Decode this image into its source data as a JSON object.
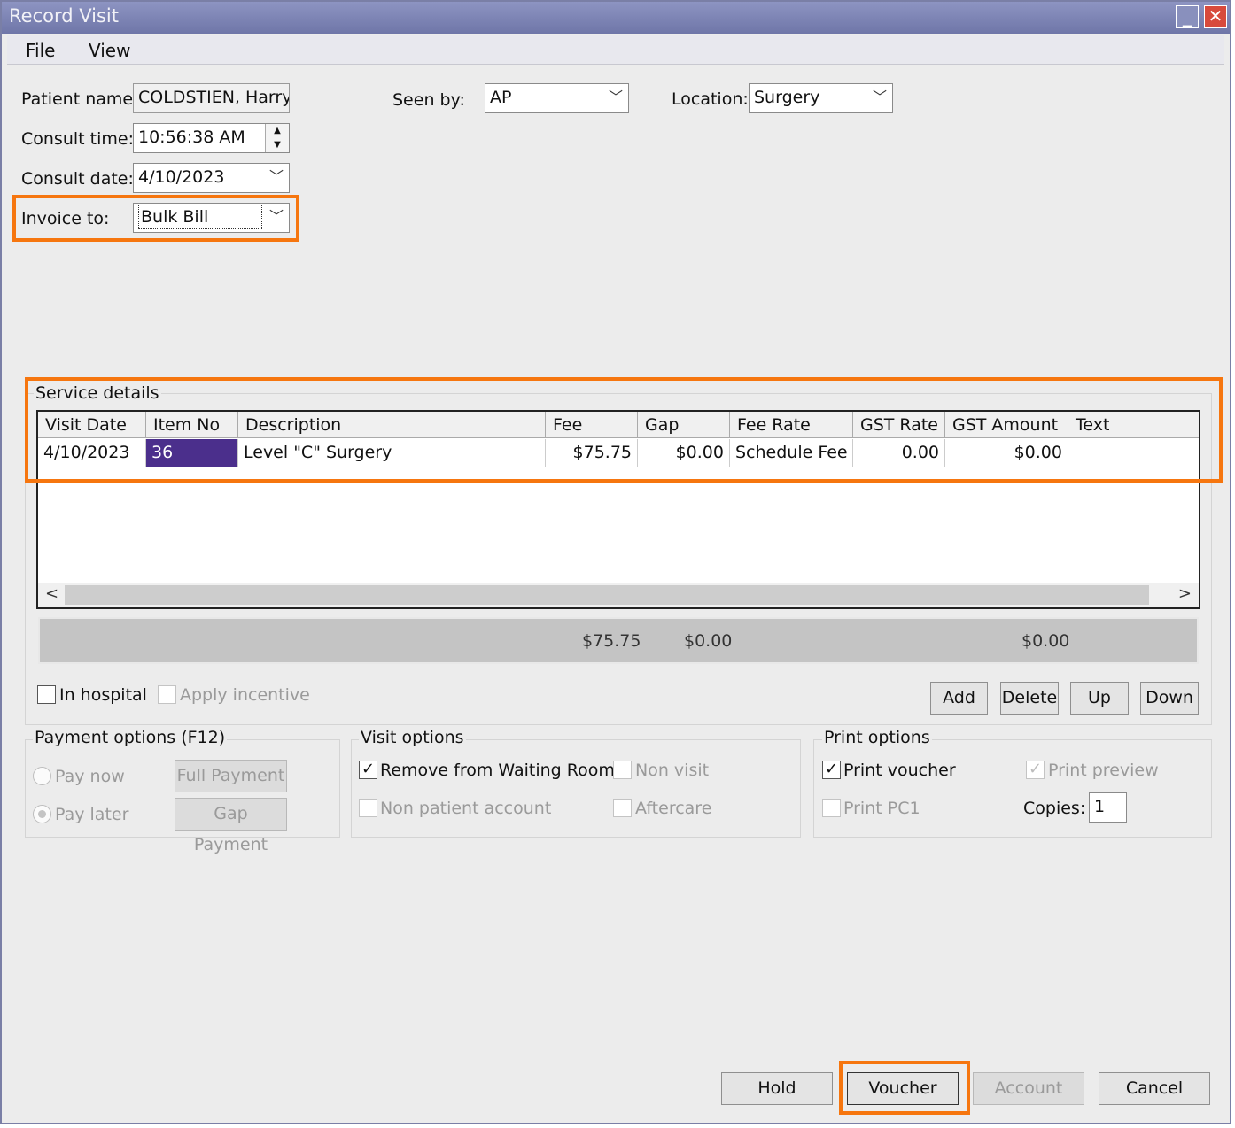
{
  "window": {
    "title": "Record Visit",
    "minimize_glyph": "_",
    "close_glyph": "✕"
  },
  "menu": {
    "file": "File",
    "view": "View"
  },
  "form": {
    "patient_name_label": "Patient name:",
    "patient_name_value": "COLDSTIEN, Harry",
    "consult_time_label": "Consult time:",
    "consult_time_value": "10:56:38 AM",
    "consult_date_label": "Consult date:",
    "consult_date_value": "4/10/2023",
    "invoice_to_label": "Invoice to:",
    "invoice_to_value": "Bulk Bill",
    "seen_by_label": "Seen by:",
    "seen_by_value": "AP",
    "location_label": "Location:",
    "location_value": "Surgery"
  },
  "service": {
    "title": "Service details",
    "columns": [
      "Visit Date",
      "Item No",
      "Description",
      "Fee",
      "Gap",
      "Fee Rate",
      "GST Rate",
      "GST Amount",
      "Text"
    ],
    "rows": [
      {
        "visit_date": "4/10/2023",
        "item_no": "36",
        "description": "Level \"C\" Surgery",
        "fee": "$75.75",
        "gap": "$0.00",
        "fee_rate": "Schedule Fee",
        "gst_rate": "0.00",
        "gst_amount": "$0.00",
        "text": ""
      }
    ],
    "totals": {
      "fee": "$75.75",
      "gap": "$0.00",
      "gst_amount": "$0.00"
    },
    "in_hospital_label": "In hospital",
    "apply_incentive_label": "Apply incentive",
    "add_label": "Add",
    "delete_label": "Delete",
    "up_label": "Up",
    "down_label": "Down"
  },
  "payment": {
    "title": "Payment options (F12)",
    "pay_now": "Pay now",
    "pay_later": "Pay later",
    "full_payment": "Full Payment",
    "gap_payment": "Gap Payment"
  },
  "visit_options": {
    "title": "Visit options",
    "remove_waiting": "Remove from Waiting Room",
    "non_visit": "Non visit",
    "non_patient": "Non patient account",
    "aftercare": "Aftercare"
  },
  "print_options": {
    "title": "Print options",
    "print_voucher": "Print voucher",
    "print_preview": "Print preview",
    "print_pc1": "Print PC1",
    "copies_label": "Copies:",
    "copies_value": "1"
  },
  "footer": {
    "hold": "Hold",
    "voucher": "Voucher",
    "account": "Account",
    "cancel": "Cancel"
  },
  "colors": {
    "highlight": "#f6760f",
    "selected_cell": "#4b2f8c",
    "titlebar": "#7a80b0"
  }
}
